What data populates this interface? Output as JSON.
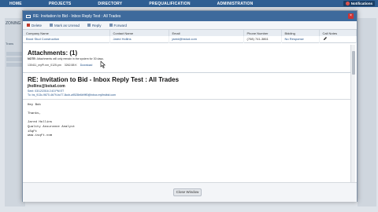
{
  "topnav": {
    "items": [
      "HOME",
      "PROJECTS",
      "DIRECTORY",
      "PREQUALIFICATION",
      "ADMINISTRATION"
    ],
    "notifications_label": "Notifications"
  },
  "background": {
    "section_title": "ZONING",
    "sub_label": "Trans"
  },
  "modal": {
    "title": "RE: Invitation to Bid - Inbox Reply Test : All Trades",
    "toolbar": {
      "delete_label": "Delete",
      "mark_unread_label": "Mark as Unread",
      "reply_label": "Reply",
      "forward_label": "Forward"
    },
    "table": {
      "headers": [
        "Company Name",
        "Contact Name",
        "Email",
        "Phone Number",
        "Bidding",
        "Call Notes"
      ],
      "row": [
        "Brust Stud Construction",
        "Jared Hollins",
        "jared@bstud.com",
        "(708) 741-3861",
        "No Response",
        ""
      ]
    },
    "attachments": {
      "title": "Attachments: (1)",
      "note_label": "NOTE:",
      "note_text": "Attachments will only remain in the system for 30 days.",
      "file_name": "130411_myPI.nm_0125.pm",
      "file_size": "3262.88 K",
      "download_label": "Download"
    },
    "email": {
      "title": "RE: Invitation to Bid - Inbox Reply Test : All Trades",
      "from": "jhollins@bstud.com",
      "sent": "Sent: 03/12/2016 2:43 PM ET",
      "to": "To: bs_913c-9670-4b79-bc77-8ccb-a9528e6b9ff0@inbox.myfirstbid.com",
      "body_lines": [
        "Hey Bob",
        "",
        "Thanks,",
        "",
        "Jared Hollins",
        "Quality Assurance Analyst",
        "iSqFt",
        "www.isqft.com"
      ]
    },
    "close_window_label": "Close Window"
  }
}
